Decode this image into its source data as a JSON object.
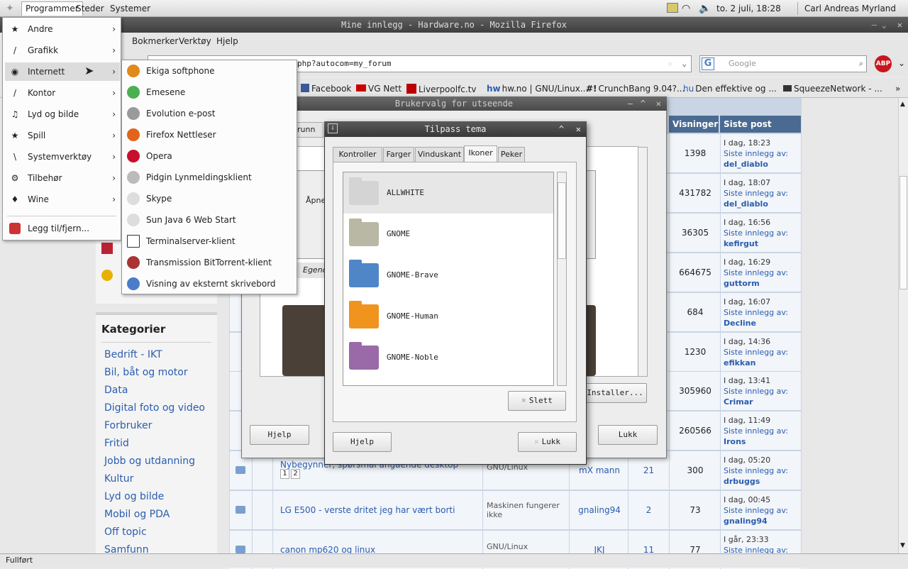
{
  "panel": {
    "menus": [
      "Programmer",
      "Steder",
      "Systemer"
    ],
    "clock": "to.  2 juli, 18:28",
    "user": "Carl Andreas Myrland"
  },
  "firefox": {
    "title": "Mine innlegg - Hardware.no - Mozilla Firefox",
    "menu": [
      "Bokmerker",
      "Verktøy",
      "Hjelp"
    ],
    "url": "php?autocom=my_forum",
    "search_placeholder": "Google",
    "adblock": "ABP",
    "status": "Fullført",
    "bookmarks": [
      "Facebook",
      "VG Nett",
      "Liverpoolfc.tv",
      "hw.no | GNU/Linux...",
      "CrunchBang 9.04?...",
      "Den effektive og ...",
      "SqueezeNetwork - ..."
    ]
  },
  "appmenu": {
    "items": [
      {
        "label": "Andre",
        "icon": "star-icon"
      },
      {
        "label": "Grafikk",
        "icon": "brush-icon"
      },
      {
        "label": "Internett",
        "icon": "globe-icon"
      },
      {
        "label": "Kontor",
        "icon": "pen-icon"
      },
      {
        "label": "Lyd og bilde",
        "icon": "media-icon"
      },
      {
        "label": "Spill",
        "icon": "star-icon"
      },
      {
        "label": "Systemverktøy",
        "icon": "tools-icon"
      },
      {
        "label": "Tilbehør",
        "icon": "gear-icon"
      },
      {
        "label": "Wine",
        "icon": "wine-icon"
      }
    ],
    "add_remove": "Legg til/fjern..."
  },
  "submenu": {
    "items": [
      "Ekiga softphone",
      "Emesene",
      "Evolution e-post",
      "Firefox Nettleser",
      "Opera",
      "Pidgin Lynmeldingsklient",
      "Skype",
      "Sun Java 6 Web Start",
      "Terminalserver-klient",
      "Transmission BitTorrent-klient",
      "Visning av eksternt skrivebord"
    ]
  },
  "dlg_back": {
    "title": "Brukervalg for utseende",
    "help": "Hjelp",
    "close": "Lukk",
    "install": "Installer...",
    "frag1": "runn",
    "frag2": "Åpne",
    "frag3": "Egend"
  },
  "dlg_theme": {
    "title": "Tilpass tema",
    "tabs": [
      "Kontroller",
      "Farger",
      "Vinduskant",
      "Ikoner",
      "Peker"
    ],
    "themes": [
      "ALLWHITE",
      "GNOME",
      "GNOME-Brave",
      "GNOME-Human",
      "GNOME-Noble"
    ],
    "delete": "Slett",
    "help": "Hjelp",
    "close": "Lukk"
  },
  "sidebar": {
    "heading": "Kategorier",
    "items": [
      "Bedrift - IKT",
      "Bil, båt og motor",
      "Data",
      "Digital foto og video",
      "Forbruker",
      "Fritid",
      "Jobb og utdanning",
      "Kultur",
      "Lyd og bilde",
      "Mobil og PDA",
      "Off topic",
      "Samfunn"
    ]
  },
  "forum": {
    "headers": {
      "views": "Visninger",
      "last": "Siste post"
    },
    "last_prefix": "Siste innlegg av:",
    "rows": [
      {
        "views": "1398",
        "time": "I dag, 18:23",
        "user": "del_diablo"
      },
      {
        "views": "431782",
        "time": "I dag, 18:07",
        "user": "del_diablo"
      },
      {
        "views": "36305",
        "time": "I dag, 16:56",
        "user": "kefirgut"
      },
      {
        "views": "664675",
        "time": "I dag, 16:29",
        "user": "guttorm"
      },
      {
        "views": "684",
        "time": "I dag, 16:07",
        "user": "Decline"
      },
      {
        "views": "1230",
        "time": "I dag, 14:36",
        "user": "efikkan"
      },
      {
        "views": "305960",
        "time": "I dag, 13:41",
        "user": "Crimar"
      },
      {
        "views": "260566",
        "time": "I dag, 11:49",
        "user": "Irons"
      },
      {
        "views": "300",
        "time": "I dag, 05:20",
        "user": "drbuggs",
        "topic": "Nybegynner, spørsmål angående desktop",
        "forum": "GNU/Linux",
        "starter": "mX mann",
        "replies": "21",
        "pages": [
          "1",
          "2"
        ]
      },
      {
        "views": "73",
        "time": "I dag, 00:45",
        "user": "gnaling94",
        "topic": "LG E500 - verste dritet jeg har vært borti",
        "forum": "Maskinen fungerer ikke",
        "starter": "gnaling94",
        "replies": "2"
      },
      {
        "views": "77",
        "time": "I går, 23:33",
        "user": "",
        "topic": "canon mp620 og linux",
        "forum": "GNU/Linux",
        "starter": "JKJ",
        "replies": "11"
      }
    ]
  }
}
